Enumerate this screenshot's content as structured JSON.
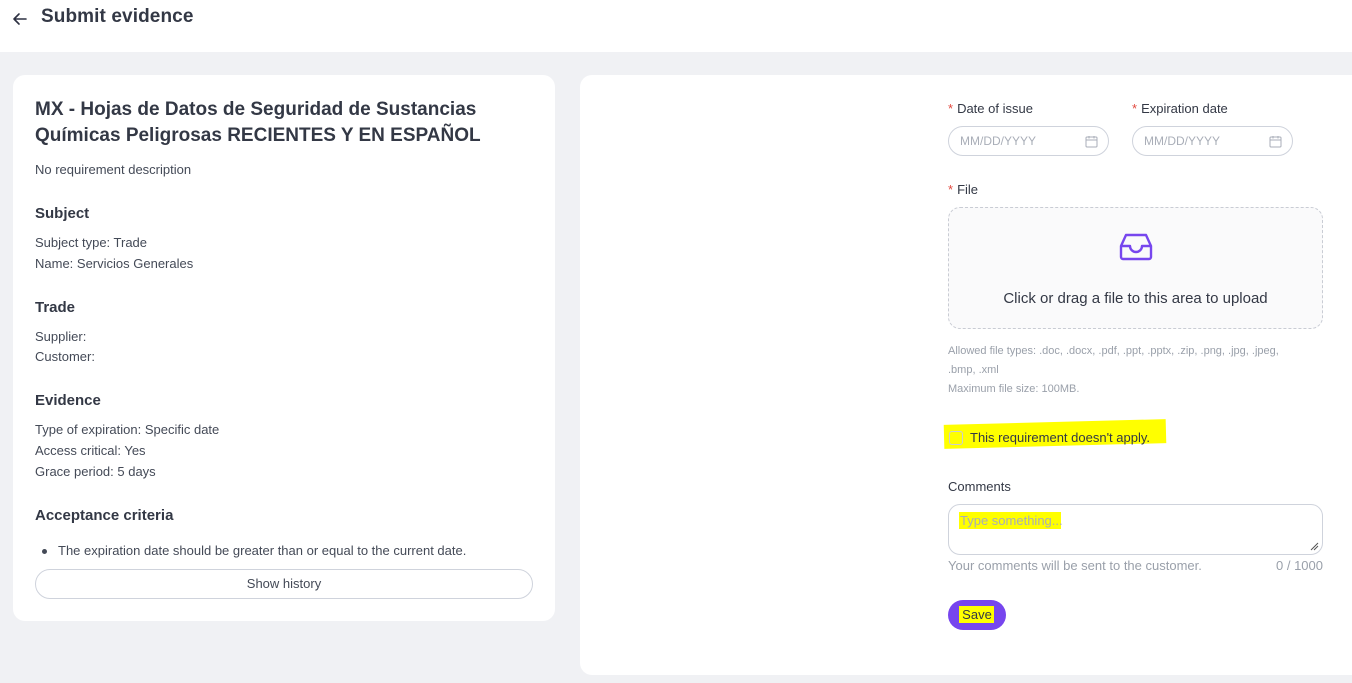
{
  "header": {
    "title": "Submit evidence",
    "back_icon": "arrow-left-icon"
  },
  "requirement": {
    "title": "MX - Hojas de Datos de Seguridad de Sustancias Químicas Peligrosas RECIENTES Y EN ESPAÑOL",
    "description": "No requirement description"
  },
  "subject": {
    "heading": "Subject",
    "type_line": "Subject type: Trade",
    "name_line": "Name: Servicios Generales"
  },
  "trade": {
    "heading": "Trade",
    "supplier_line": "Supplier:",
    "customer_line": "Customer:"
  },
  "evidence": {
    "heading": "Evidence",
    "expiration_line": "Type of expiration: Specific date",
    "access_line": "Access critical: Yes",
    "grace_line": "Grace period: 5 days"
  },
  "acceptance": {
    "heading": "Acceptance criteria",
    "items": [
      "The expiration date should be greater than or equal to the current date."
    ]
  },
  "show_history_label": "Show history",
  "form": {
    "required_mark": "*",
    "date_of_issue": {
      "label": "Date of issue",
      "placeholder": "MM/DD/YYYY"
    },
    "expiration_date": {
      "label": "Expiration date",
      "placeholder": "MM/DD/YYYY"
    },
    "file": {
      "label": "File",
      "upload_text": "Click or drag a file to this area to upload",
      "allowed_line1": "Allowed file types: .doc, .docx, .pdf, .ppt, .pptx, .zip, .png, .jpg, .jpeg,",
      "allowed_line2": ".bmp, .xml",
      "max_size": "Maximum file size: 100MB."
    },
    "not_apply_label": "This requirement doesn't apply.",
    "not_apply_checked": false,
    "comments": {
      "label": "Comments",
      "placeholder": "Type something...",
      "hint": "Your comments will be sent to the customer.",
      "counter": "0 / 1000"
    },
    "save_label": "Save"
  },
  "colors": {
    "accent": "#7746ee",
    "highlight": "#ffff00",
    "required": "#e2493f",
    "background": "#f0f1f4"
  }
}
